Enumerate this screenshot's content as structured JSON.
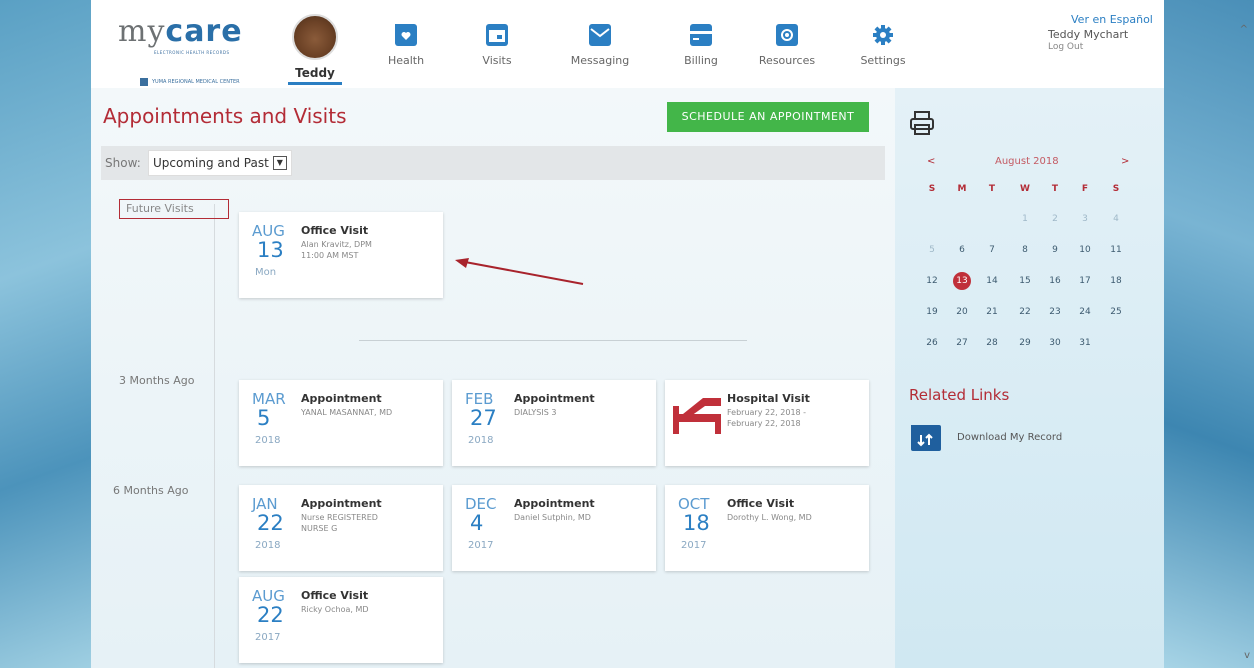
{
  "header": {
    "logo_my": "my",
    "logo_care": "care",
    "logo_tagline": "ELECTRONIC HEALTH RECORDS",
    "logo_hospital": "YUMA REGIONAL MEDICAL CENTER",
    "nav": [
      {
        "label": "Teddy",
        "icon": "teddy-avatar"
      },
      {
        "label": "Health",
        "icon": "folder-heart-icon"
      },
      {
        "label": "Visits",
        "icon": "calendar-icon"
      },
      {
        "label": "Messaging",
        "icon": "envelope-icon"
      },
      {
        "label": "Billing",
        "icon": "credit-card-icon"
      },
      {
        "label": "Resources",
        "icon": "resource-icon"
      },
      {
        "label": "Settings",
        "icon": "gear-icon"
      }
    ],
    "language_link": "Ver en Español",
    "user_name": "Teddy Mychart",
    "logout": "Log Out"
  },
  "main": {
    "title": "Appointments and Visits",
    "schedule_button": "SCHEDULE AN APPOINTMENT",
    "filter_label": "Show:",
    "filter_value": "Upcoming and Past",
    "sections": {
      "future": "Future Visits",
      "three_months": "3 Months Ago",
      "six_months": "6 Months Ago"
    },
    "cards": [
      {
        "mon": "AUG",
        "day": "13",
        "sub": "Mon",
        "title": "Office Visit",
        "line1": "Alan Kravitz, DPM",
        "line2": "11:00 AM MST"
      },
      {
        "mon": "MAR",
        "day": "5",
        "sub": "2018",
        "title": "Appointment",
        "line1": "YANAL MASANNAT, MD",
        "line2": ""
      },
      {
        "mon": "FEB",
        "day": "27",
        "sub": "2018",
        "title": "Appointment",
        "line1": "DIALYSIS 3",
        "line2": ""
      },
      {
        "mon": "",
        "day": "",
        "sub": "",
        "title": "Hospital Visit",
        "line1": "February 22, 2018 -",
        "line2": "February 22, 2018"
      },
      {
        "mon": "JAN",
        "day": "22",
        "sub": "2018",
        "title": "Appointment",
        "line1": "Nurse REGISTERED",
        "line2": "NURSE G"
      },
      {
        "mon": "DEC",
        "day": "4",
        "sub": "2017",
        "title": "Appointment",
        "line1": "Daniel Sutphin, MD",
        "line2": ""
      },
      {
        "mon": "OCT",
        "day": "18",
        "sub": "2017",
        "title": "Office Visit",
        "line1": "Dorothy L. Wong, MD",
        "line2": ""
      },
      {
        "mon": "AUG",
        "day": "22",
        "sub": "2017",
        "title": "Office Visit",
        "line1": "Ricky Ochoa, MD",
        "line2": ""
      }
    ]
  },
  "sidebar": {
    "calendar": {
      "prev": "<",
      "next": ">",
      "month": "August 2018",
      "weekdays": [
        "S",
        "M",
        "T",
        "W",
        "T",
        "F",
        "S"
      ],
      "weeks": [
        [
          "",
          "",
          "",
          "1",
          "2",
          "3",
          "4"
        ],
        [
          "5",
          "6",
          "7",
          "8",
          "9",
          "10",
          "11"
        ],
        [
          "12",
          "13",
          "14",
          "15",
          "16",
          "17",
          "18"
        ],
        [
          "19",
          "20",
          "21",
          "22",
          "23",
          "24",
          "25"
        ],
        [
          "26",
          "27",
          "28",
          "29",
          "30",
          "31",
          ""
        ]
      ],
      "highlighted_day": "13"
    },
    "related_links_title": "Related Links",
    "download_link": "Download My Record"
  },
  "colors": {
    "brand_blue": "#2b7fc3",
    "title_red": "#b32c36",
    "button_green": "#43b649",
    "hospital_bed": "#c0303a"
  }
}
